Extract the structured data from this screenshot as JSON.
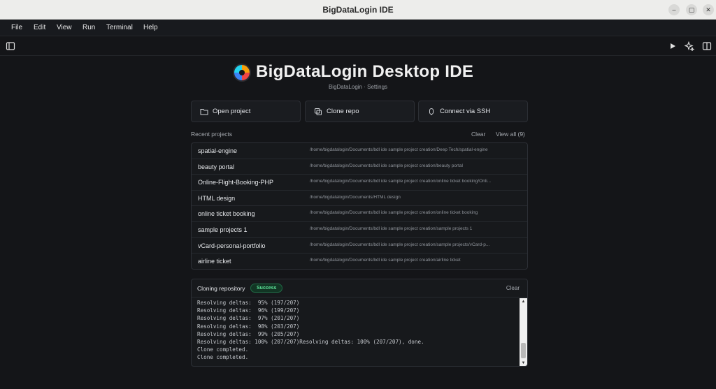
{
  "window": {
    "title": "BigDataLogin IDE",
    "controls": {
      "minimize": "–",
      "maximize": "▢",
      "close": "✕"
    }
  },
  "menu": [
    "File",
    "Edit",
    "View",
    "Run",
    "Terminal",
    "Help"
  ],
  "toolbar": {
    "icons": [
      "sidebar-toggle-icon",
      "play-icon",
      "sparkle-icon",
      "split-view-icon"
    ]
  },
  "header": {
    "title": "BigDataLogin Desktop IDE",
    "subtitle": "BigDataLogin · Settings"
  },
  "actions": [
    {
      "label": "Open project",
      "icon": "folder-icon"
    },
    {
      "label": "Clone repo",
      "icon": "copy-icon"
    },
    {
      "label": "Connect via SSH",
      "icon": "ssh-icon"
    }
  ],
  "recent": {
    "label": "Recent projects",
    "clear": "Clear",
    "view_all": "View all (9)",
    "items": [
      {
        "name": "spatial-engine",
        "path": "/home/bigdatalogin/Documents/bdl ide sample project creation/Deep Tech/spatial-engine"
      },
      {
        "name": "beauty portal",
        "path": "/home/bigdatalogin/Documents/bdl ide sample project creation/beauty portal"
      },
      {
        "name": "Online-Flight-Booking-PHP",
        "path": "/home/bigdatalogin/Documents/bdl ide sample project creation/online ticket booking/Onli..."
      },
      {
        "name": "HTML design",
        "path": "/home/bigdatalogin/Documents/HTML design"
      },
      {
        "name": "online ticket booking",
        "path": "/home/bigdatalogin/Documents/bdl ide sample project creation/online ticket booking"
      },
      {
        "name": "sample projects 1",
        "path": "/home/bigdatalogin/Documents/bdl ide sample project creation/sample projects 1"
      },
      {
        "name": "vCard-personal-portfolio",
        "path": "/home/bigdatalogin/Documents/bdl ide sample project creation/sample projects/vCard-p..."
      },
      {
        "name": "airline ticket",
        "path": "/home/bigdatalogin/Documents/bdl ide sample project creation/airline ticket"
      }
    ]
  },
  "clone": {
    "title": "Cloning repository",
    "status": "Success",
    "status_color": "#5ee39a",
    "clear": "Clear",
    "log": [
      "Resolving deltas:  95% (197/207)",
      "Resolving deltas:  96% (199/207)",
      "Resolving deltas:  97% (201/207)",
      "Resolving deltas:  98% (203/207)",
      "Resolving deltas:  99% (205/207)",
      "Resolving deltas: 100% (207/207)Resolving deltas: 100% (207/207), done.",
      "Clone completed.",
      "Clone completed."
    ],
    "scroll_up": "▲",
    "scroll_down": "▼"
  }
}
